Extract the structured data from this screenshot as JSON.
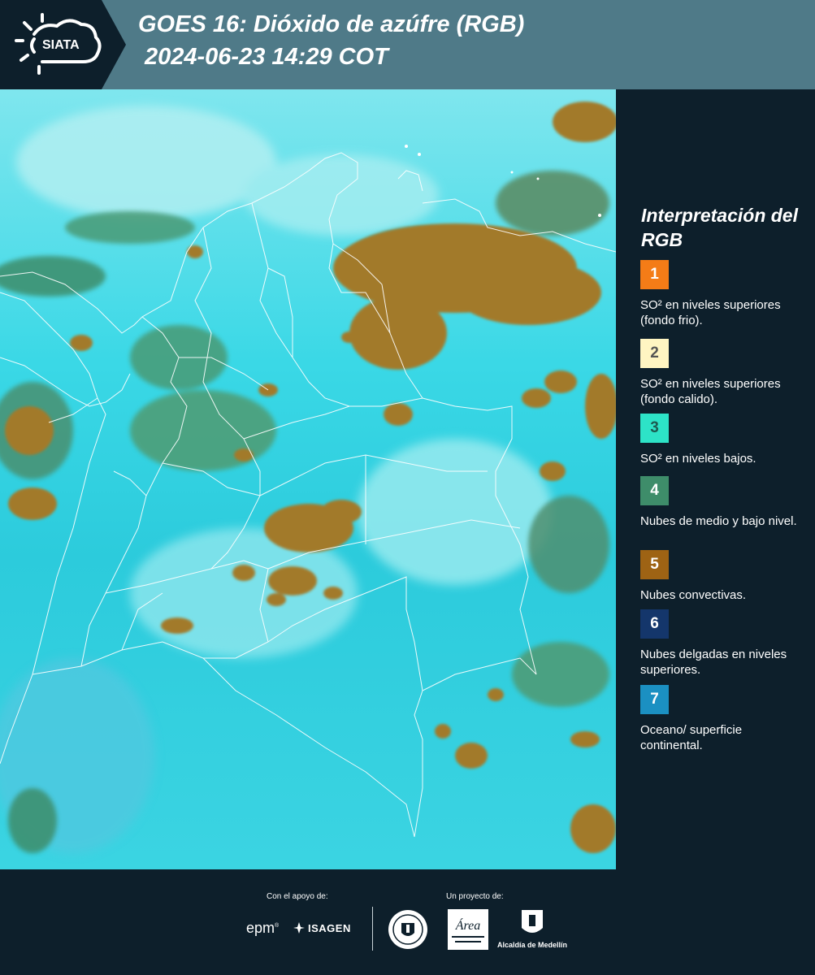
{
  "header": {
    "logo_text": "SIATA",
    "title": "GOES 16: Dióxido de azúfre (RGB)",
    "subtitle": " 2024-06-23 14:29 COT"
  },
  "legend": {
    "title": "Interpretación del RGB",
    "items": [
      {
        "number": "1",
        "label": "SO² en niveles superiores (fondo frio).",
        "color": "#f47c17",
        "num_color": "#ffffff"
      },
      {
        "number": "2",
        "label": "SO² en niveles superiores (fondo calido).",
        "color": "#fff5c2",
        "num_color": "#555555"
      },
      {
        "number": "3",
        "label": "SO² en niveles bajos.",
        "color": "#2de3c7",
        "num_color": "#1d5a50"
      },
      {
        "number": "4",
        "label": "Nubes de medio y bajo nivel.",
        "color": "#3e8d6a",
        "num_color": "#ffffff"
      },
      {
        "number": "5",
        "label": "Nubes convectivas.",
        "color": "#9e6314",
        "num_color": "#ffffff"
      },
      {
        "number": "6",
        "label": "Nubes delgadas en niveles superiores.",
        "color": "#14366b",
        "num_color": "#ffffff"
      },
      {
        "number": "7",
        "label": "Oceano/ superficie continental.",
        "color": "#1b90c2",
        "num_color": "#ffffff"
      }
    ]
  },
  "footer": {
    "support_label": "Con el apoyo de:",
    "project_label": "Un proyecto de:",
    "epm": "epm",
    "epm_mark": "®",
    "isagen": "ISAGEN",
    "area_logo_text": "Área",
    "alcaldia": "Alcaldía de Medellín"
  },
  "colors": {
    "header_bg": "#4f7a88",
    "panel_bg": "#0d1f2b",
    "cloud_cyan": "#3ad8e6",
    "cloud_brown": "#a0782e",
    "border_lines": "#ffffff"
  }
}
